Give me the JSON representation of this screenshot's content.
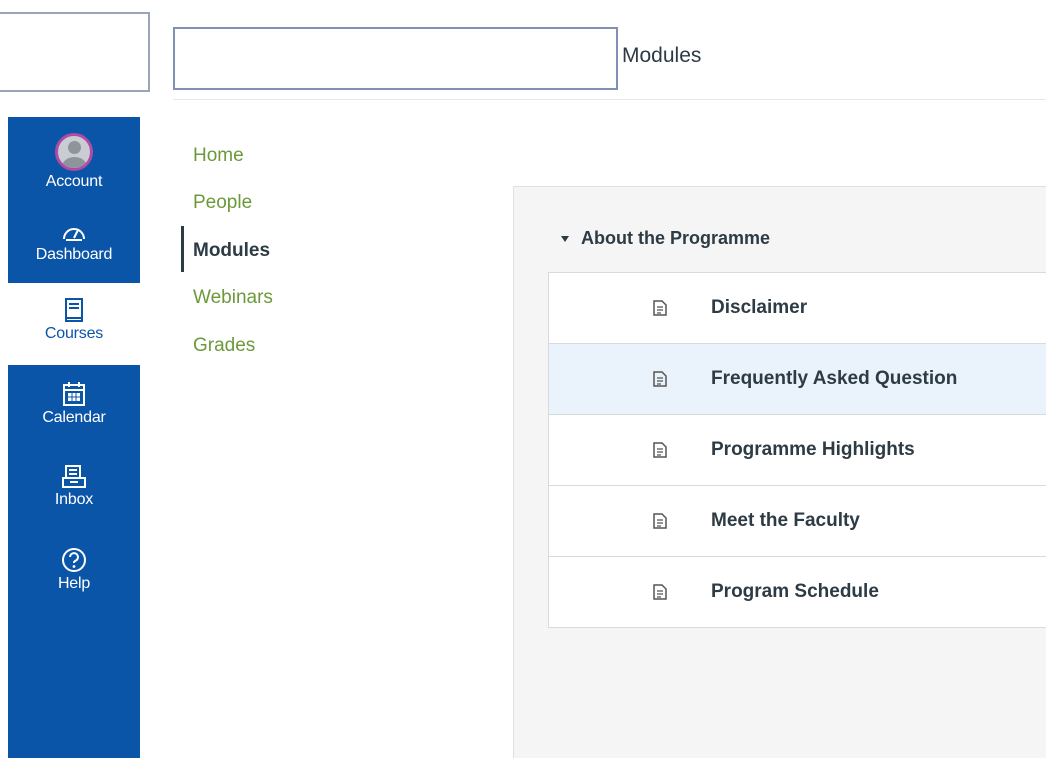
{
  "header": {
    "page_title": "Modules"
  },
  "global_nav": {
    "items": [
      {
        "label": "Account",
        "icon": "avatar-icon"
      },
      {
        "label": "Dashboard",
        "icon": "dashboard-icon"
      },
      {
        "label": "Courses",
        "icon": "courses-icon"
      },
      {
        "label": "Calendar",
        "icon": "calendar-icon"
      },
      {
        "label": "Inbox",
        "icon": "inbox-icon"
      },
      {
        "label": "Help",
        "icon": "help-icon"
      }
    ],
    "active": "Courses",
    "colors": {
      "background": "#0b55a8",
      "text": "#ffffff"
    }
  },
  "course_nav": {
    "items": [
      {
        "label": "Home"
      },
      {
        "label": "People"
      },
      {
        "label": "Modules"
      },
      {
        "label": "Webinars"
      },
      {
        "label": "Grades"
      }
    ],
    "active": "Modules",
    "colors": {
      "link": "#6b9a3a",
      "active": "#2d3b45"
    }
  },
  "module": {
    "title": "About the Programme",
    "items": [
      {
        "title": "Disclaimer",
        "icon": "page-icon"
      },
      {
        "title": "Frequently Asked Question",
        "icon": "page-icon"
      },
      {
        "title": "Programme Highlights",
        "icon": "page-icon"
      },
      {
        "title": "Meet the Faculty",
        "icon": "page-icon"
      },
      {
        "title": "Program Schedule",
        "icon": "page-icon"
      }
    ]
  }
}
